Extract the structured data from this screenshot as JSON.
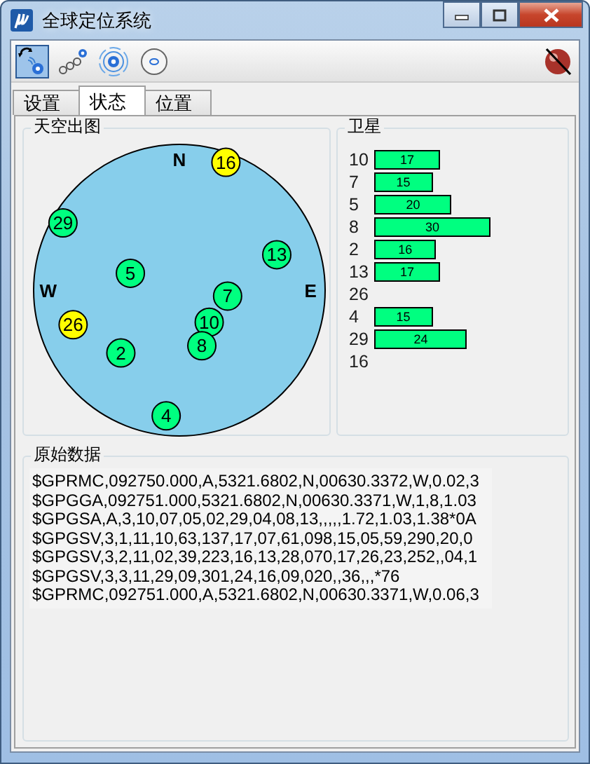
{
  "window": {
    "title": "全球定位系统"
  },
  "toolbar": {
    "buttons": [
      {
        "kind": "connect",
        "selected": true
      },
      {
        "kind": "satellites",
        "selected": false
      },
      {
        "kind": "signal",
        "selected": false
      },
      {
        "kind": "disc",
        "selected": false
      }
    ],
    "right_button": {
      "kind": "stop"
    }
  },
  "tabs": [
    {
      "label": "设置",
      "selected": false
    },
    {
      "label": "状态",
      "selected": true
    },
    {
      "label": "位置",
      "selected": false
    }
  ],
  "sky_plot": {
    "title": "天空出图",
    "directions": [
      "N",
      "W",
      "E"
    ],
    "satellites": [
      {
        "number": "16",
        "color": "#ffff00"
      },
      {
        "number": "29",
        "color": "#00ff80"
      },
      {
        "number": "13",
        "color": "#00ff80"
      },
      {
        "number": "5",
        "color": "#00ff80"
      },
      {
        "number": "7",
        "color": "#00ff80"
      },
      {
        "number": "26",
        "color": "#ffff00"
      },
      {
        "number": "10",
        "color": "#00ff80"
      },
      {
        "number": "8",
        "color": "#00ff80"
      },
      {
        "number": "2",
        "color": "#00ff80"
      },
      {
        "number": "4",
        "color": "#00ff80"
      }
    ]
  },
  "satellite_signals": {
    "title": "卫星",
    "rows": [
      {
        "number": "10",
        "snr": "17"
      },
      {
        "number": "7",
        "snr": "15"
      },
      {
        "number": "5",
        "snr": "20"
      },
      {
        "number": "8",
        "snr": "30"
      },
      {
        "number": "2",
        "snr": "16"
      },
      {
        "number": "13",
        "snr": "17"
      },
      {
        "number": "26"
      },
      {
        "number": "4",
        "snr": "15"
      },
      {
        "number": "29",
        "snr": "24"
      },
      {
        "number": "16"
      }
    ]
  },
  "raw_data": {
    "title": "原始数据",
    "lines": [
      "$GPRMC,092750.000,A,5321.6802,N,00630.3372,W,0.02,3",
      "$GPGGA,092751.000,5321.6802,N,00630.3371,W,1,8,1.03",
      "$GPGSA,A,3,10,07,05,02,29,04,08,13,,,,,1.72,1.03,1.38*0A",
      "$GPGSV,3,1,11,10,63,137,17,07,61,098,15,05,59,290,20,0",
      "$GPGSV,3,2,11,02,39,223,16,13,28,070,17,26,23,252,,04,1",
      "$GPGSV,3,3,11,29,09,301,24,16,09,020,,36,,,*76",
      "$GPRMC,092751.000,A,5321.6802,N,00630.3371,W,0.06,3"
    ]
  }
}
